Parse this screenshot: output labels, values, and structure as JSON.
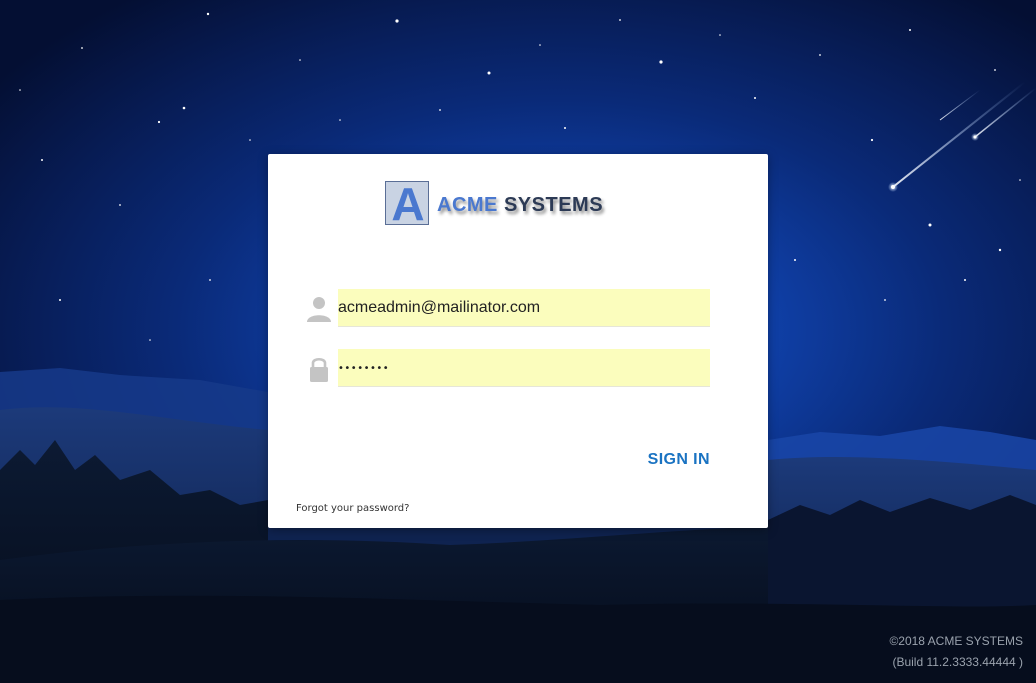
{
  "logo": {
    "letter": "A",
    "word1": "ACME",
    "word2": "SYSTEMS",
    "box_color": "#c9d3e3",
    "letter_color": "#4a78cf"
  },
  "login": {
    "username_value": "acmeadmin@mailinator.com",
    "password_value": "••••••••",
    "username_icon": "user-icon",
    "password_icon": "lock-icon",
    "sign_in_label": "SIGN IN",
    "forgot_label": "Forgot your password?"
  },
  "footer": {
    "copyright": "©2018 ACME SYSTEMS",
    "build": "(Build 11.2.3333.44444 )"
  },
  "colors": {
    "accent": "#1a73c2",
    "autofill_bg": "#fbfdbd",
    "card_bg": "#ffffff"
  }
}
